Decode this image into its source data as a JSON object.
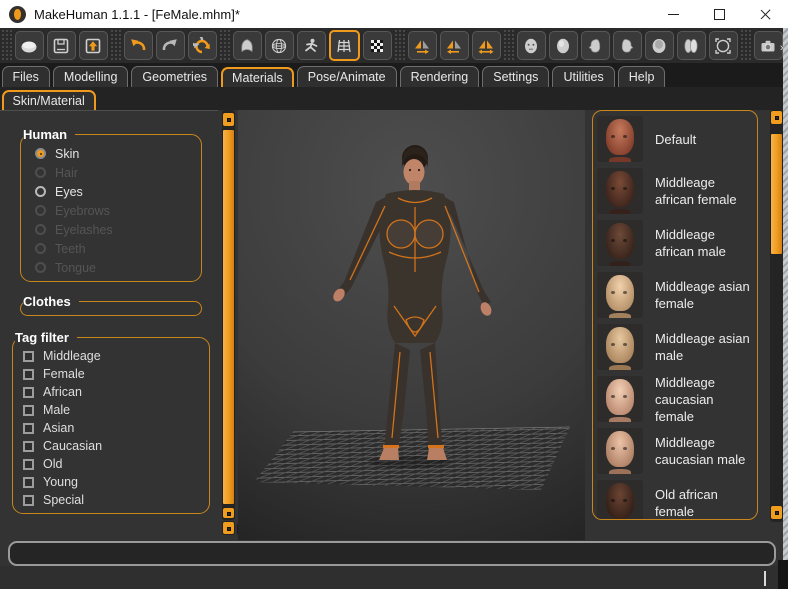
{
  "window": {
    "title": "MakeHuman 1.1.1 - [FeMale.mhm]*"
  },
  "titlebar": {
    "buttons": [
      "minimize",
      "maximize",
      "close"
    ]
  },
  "colors": {
    "accent": "#EF9A1D",
    "group_border": "#C9861C",
    "scroll_orange": "#F09C1E",
    "toolbar_bg": "#2a2a2a",
    "panel_bg": "#333333",
    "titlebar_bg": "#ffffff",
    "disabled_text": "#555555"
  },
  "toolbar": {
    "overflow_label": "»",
    "buttons": [
      {
        "name": "new-mesh",
        "active": false
      },
      {
        "name": "save",
        "active": false
      },
      {
        "name": "load",
        "active": false
      },
      {
        "name": "undo",
        "active": false
      },
      {
        "name": "redo",
        "active": false
      },
      {
        "name": "reset-mesh",
        "active": false
      },
      {
        "name": "smooth-shading",
        "active": false
      },
      {
        "name": "wireframe",
        "active": false
      },
      {
        "name": "pose",
        "active": false
      },
      {
        "name": "grid",
        "active": true
      },
      {
        "name": "background",
        "active": false
      },
      {
        "name": "symmetry-right",
        "active": false
      },
      {
        "name": "symmetry-left",
        "active": false
      },
      {
        "name": "symmetry",
        "active": false
      },
      {
        "name": "front-view",
        "active": false
      },
      {
        "name": "back-view",
        "active": false
      },
      {
        "name": "left-view",
        "active": false
      },
      {
        "name": "right-view",
        "active": false
      },
      {
        "name": "top-view",
        "active": false
      },
      {
        "name": "side-view",
        "active": false
      },
      {
        "name": "reset-camera",
        "active": false
      },
      {
        "name": "grab-screen",
        "active": false
      }
    ]
  },
  "tabs": {
    "active": "Materials",
    "items": [
      {
        "label": "Files"
      },
      {
        "label": "Modelling"
      },
      {
        "label": "Geometries"
      },
      {
        "label": "Materials"
      },
      {
        "label": "Pose/Animate"
      },
      {
        "label": "Rendering"
      },
      {
        "label": "Settings"
      },
      {
        "label": "Utilities"
      },
      {
        "label": "Help"
      }
    ]
  },
  "subtabs": {
    "active": "Skin/Material",
    "items": [
      {
        "label": "Skin/Material"
      }
    ]
  },
  "left_panel": {
    "human": {
      "title": "Human",
      "items": [
        {
          "label": "Skin",
          "selected": true,
          "enabled": true
        },
        {
          "label": "Hair",
          "selected": false,
          "enabled": false
        },
        {
          "label": "Eyes",
          "selected": false,
          "enabled": true
        },
        {
          "label": "Eyebrows",
          "selected": false,
          "enabled": false
        },
        {
          "label": "Eyelashes",
          "selected": false,
          "enabled": false
        },
        {
          "label": "Teeth",
          "selected": false,
          "enabled": false
        },
        {
          "label": "Tongue",
          "selected": false,
          "enabled": false
        }
      ]
    },
    "clothes": {
      "title": "Clothes"
    },
    "tag_filter": {
      "title": "Tag filter",
      "items": [
        {
          "label": "Middleage",
          "checked": false
        },
        {
          "label": "Female",
          "checked": false
        },
        {
          "label": "African",
          "checked": false
        },
        {
          "label": "Male",
          "checked": false
        },
        {
          "label": "Asian",
          "checked": false
        },
        {
          "label": "Caucasian",
          "checked": false
        },
        {
          "label": "Old",
          "checked": false
        },
        {
          "label": "Young",
          "checked": false
        },
        {
          "label": "Special",
          "checked": false
        }
      ]
    }
  },
  "materials": {
    "items": [
      {
        "label": "Default",
        "skin_top": "#c67a5d",
        "skin_bottom": "#7e3a28"
      },
      {
        "label": "Middleage african female",
        "skin_top": "#7a4a36",
        "skin_bottom": "#38211a"
      },
      {
        "label": "Middleage african male",
        "skin_top": "#6e4a38",
        "skin_bottom": "#332019"
      },
      {
        "label": "Middleage asian female",
        "skin_top": "#f0d2ac",
        "skin_bottom": "#b08a62"
      },
      {
        "label": "Middleage asian male",
        "skin_top": "#e7c8a0",
        "skin_bottom": "#a67f58"
      },
      {
        "label": "Middleage caucasian female",
        "skin_top": "#f2cfb4",
        "skin_bottom": "#b5836a"
      },
      {
        "label": "Middleage caucasian male",
        "skin_top": "#ecc3a6",
        "skin_bottom": "#a87a60"
      },
      {
        "label": "Old african female",
        "skin_top": "#6b4433",
        "skin_bottom": "#2f1d15"
      },
      {
        "label": "",
        "skin_top": "#4a382c",
        "skin_bottom": "#241a14"
      }
    ]
  }
}
